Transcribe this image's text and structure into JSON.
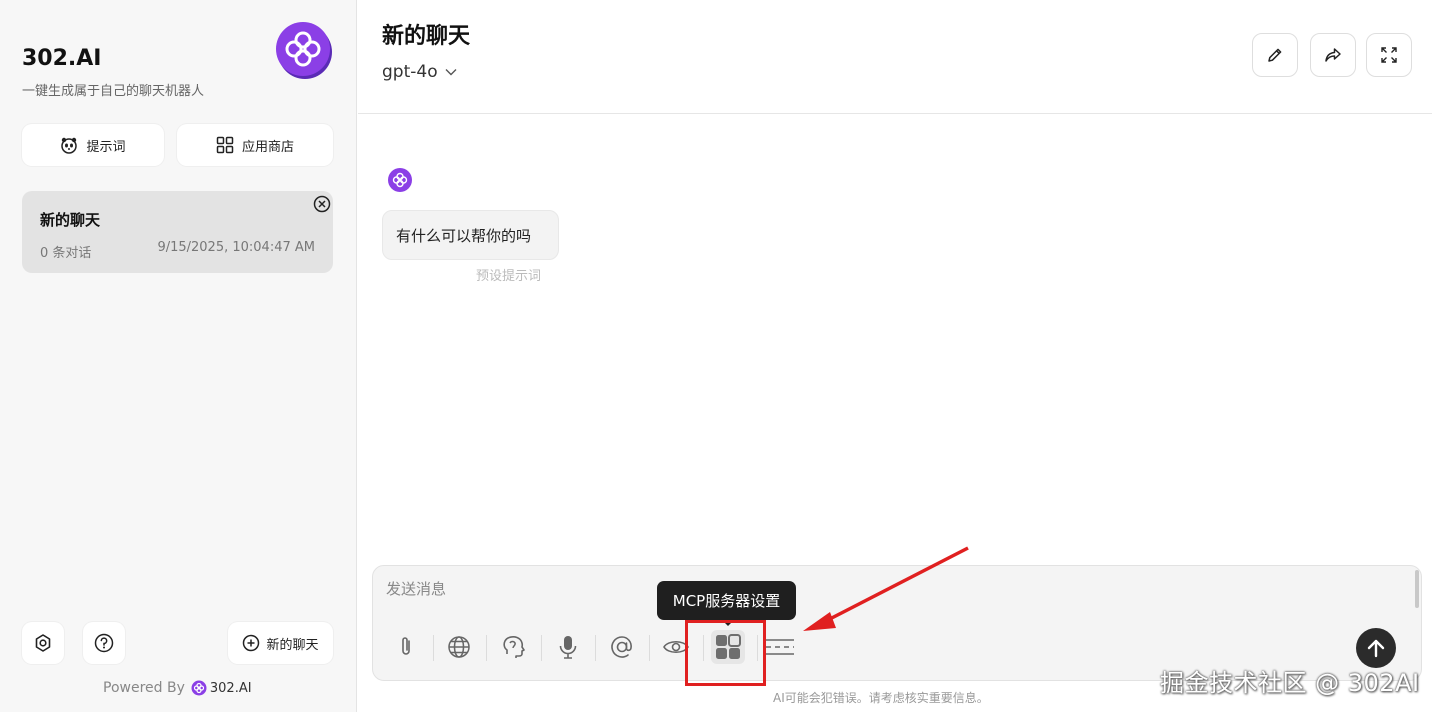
{
  "sidebar": {
    "brand_title": "302.AI",
    "brand_subtitle": "一键生成属于自己的聊天机器人",
    "prompt_button": "提示词",
    "store_button": "应用商店",
    "chat_card": {
      "title": "新的聊天",
      "count": "0 条对话",
      "time": "9/15/2025, 10:04:47 AM"
    },
    "new_chat_button": "新的聊天",
    "powered_by": "Powered By",
    "powered_brand": "302.AI"
  },
  "header": {
    "title": "新的聊天",
    "model": "gpt-4o"
  },
  "messages": [
    {
      "text": "有什么可以帮你的吗",
      "caption": "预设提示词"
    }
  ],
  "composer": {
    "placeholder": "发送消息",
    "tooltip": "MCP服务器设置"
  },
  "disclaimer": "AI可能会犯错误。请考虑核实重要信息。",
  "watermark": "掘金技术社区 @ 302AI",
  "colors": {
    "brand_purple": "#8b3fe6",
    "annotation_red": "#e02020",
    "send_button": "#2b2b2b"
  }
}
